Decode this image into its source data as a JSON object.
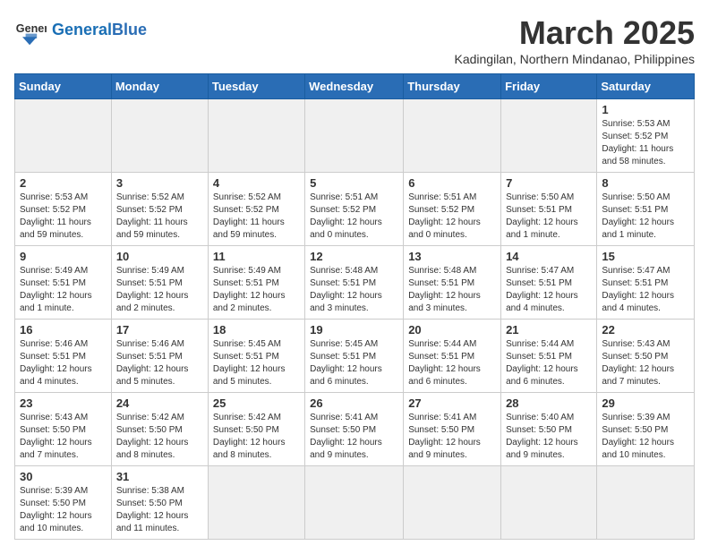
{
  "header": {
    "logo_general": "General",
    "logo_blue": "Blue",
    "month_title": "March 2025",
    "subtitle": "Kadingilan, Northern Mindanao, Philippines"
  },
  "weekdays": [
    "Sunday",
    "Monday",
    "Tuesday",
    "Wednesday",
    "Thursday",
    "Friday",
    "Saturday"
  ],
  "weeks": [
    [
      {
        "day": "",
        "info": "",
        "empty": true
      },
      {
        "day": "",
        "info": "",
        "empty": true
      },
      {
        "day": "",
        "info": "",
        "empty": true
      },
      {
        "day": "",
        "info": "",
        "empty": true
      },
      {
        "day": "",
        "info": "",
        "empty": true
      },
      {
        "day": "",
        "info": "",
        "empty": true
      },
      {
        "day": "1",
        "info": "Sunrise: 5:53 AM\nSunset: 5:52 PM\nDaylight: 11 hours and 58 minutes.",
        "empty": false
      }
    ],
    [
      {
        "day": "2",
        "info": "Sunrise: 5:53 AM\nSunset: 5:52 PM\nDaylight: 11 hours and 59 minutes.",
        "empty": false
      },
      {
        "day": "3",
        "info": "Sunrise: 5:52 AM\nSunset: 5:52 PM\nDaylight: 11 hours and 59 minutes.",
        "empty": false
      },
      {
        "day": "4",
        "info": "Sunrise: 5:52 AM\nSunset: 5:52 PM\nDaylight: 11 hours and 59 minutes.",
        "empty": false
      },
      {
        "day": "5",
        "info": "Sunrise: 5:51 AM\nSunset: 5:52 PM\nDaylight: 12 hours and 0 minutes.",
        "empty": false
      },
      {
        "day": "6",
        "info": "Sunrise: 5:51 AM\nSunset: 5:52 PM\nDaylight: 12 hours and 0 minutes.",
        "empty": false
      },
      {
        "day": "7",
        "info": "Sunrise: 5:50 AM\nSunset: 5:51 PM\nDaylight: 12 hours and 1 minute.",
        "empty": false
      },
      {
        "day": "8",
        "info": "Sunrise: 5:50 AM\nSunset: 5:51 PM\nDaylight: 12 hours and 1 minute.",
        "empty": false
      }
    ],
    [
      {
        "day": "9",
        "info": "Sunrise: 5:49 AM\nSunset: 5:51 PM\nDaylight: 12 hours and 1 minute.",
        "empty": false
      },
      {
        "day": "10",
        "info": "Sunrise: 5:49 AM\nSunset: 5:51 PM\nDaylight: 12 hours and 2 minutes.",
        "empty": false
      },
      {
        "day": "11",
        "info": "Sunrise: 5:49 AM\nSunset: 5:51 PM\nDaylight: 12 hours and 2 minutes.",
        "empty": false
      },
      {
        "day": "12",
        "info": "Sunrise: 5:48 AM\nSunset: 5:51 PM\nDaylight: 12 hours and 3 minutes.",
        "empty": false
      },
      {
        "day": "13",
        "info": "Sunrise: 5:48 AM\nSunset: 5:51 PM\nDaylight: 12 hours and 3 minutes.",
        "empty": false
      },
      {
        "day": "14",
        "info": "Sunrise: 5:47 AM\nSunset: 5:51 PM\nDaylight: 12 hours and 4 minutes.",
        "empty": false
      },
      {
        "day": "15",
        "info": "Sunrise: 5:47 AM\nSunset: 5:51 PM\nDaylight: 12 hours and 4 minutes.",
        "empty": false
      }
    ],
    [
      {
        "day": "16",
        "info": "Sunrise: 5:46 AM\nSunset: 5:51 PM\nDaylight: 12 hours and 4 minutes.",
        "empty": false
      },
      {
        "day": "17",
        "info": "Sunrise: 5:46 AM\nSunset: 5:51 PM\nDaylight: 12 hours and 5 minutes.",
        "empty": false
      },
      {
        "day": "18",
        "info": "Sunrise: 5:45 AM\nSunset: 5:51 PM\nDaylight: 12 hours and 5 minutes.",
        "empty": false
      },
      {
        "day": "19",
        "info": "Sunrise: 5:45 AM\nSunset: 5:51 PM\nDaylight: 12 hours and 6 minutes.",
        "empty": false
      },
      {
        "day": "20",
        "info": "Sunrise: 5:44 AM\nSunset: 5:51 PM\nDaylight: 12 hours and 6 minutes.",
        "empty": false
      },
      {
        "day": "21",
        "info": "Sunrise: 5:44 AM\nSunset: 5:51 PM\nDaylight: 12 hours and 6 minutes.",
        "empty": false
      },
      {
        "day": "22",
        "info": "Sunrise: 5:43 AM\nSunset: 5:50 PM\nDaylight: 12 hours and 7 minutes.",
        "empty": false
      }
    ],
    [
      {
        "day": "23",
        "info": "Sunrise: 5:43 AM\nSunset: 5:50 PM\nDaylight: 12 hours and 7 minutes.",
        "empty": false
      },
      {
        "day": "24",
        "info": "Sunrise: 5:42 AM\nSunset: 5:50 PM\nDaylight: 12 hours and 8 minutes.",
        "empty": false
      },
      {
        "day": "25",
        "info": "Sunrise: 5:42 AM\nSunset: 5:50 PM\nDaylight: 12 hours and 8 minutes.",
        "empty": false
      },
      {
        "day": "26",
        "info": "Sunrise: 5:41 AM\nSunset: 5:50 PM\nDaylight: 12 hours and 9 minutes.",
        "empty": false
      },
      {
        "day": "27",
        "info": "Sunrise: 5:41 AM\nSunset: 5:50 PM\nDaylight: 12 hours and 9 minutes.",
        "empty": false
      },
      {
        "day": "28",
        "info": "Sunrise: 5:40 AM\nSunset: 5:50 PM\nDaylight: 12 hours and 9 minutes.",
        "empty": false
      },
      {
        "day": "29",
        "info": "Sunrise: 5:39 AM\nSunset: 5:50 PM\nDaylight: 12 hours and 10 minutes.",
        "empty": false
      }
    ],
    [
      {
        "day": "30",
        "info": "Sunrise: 5:39 AM\nSunset: 5:50 PM\nDaylight: 12 hours and 10 minutes.",
        "empty": false
      },
      {
        "day": "31",
        "info": "Sunrise: 5:38 AM\nSunset: 5:50 PM\nDaylight: 12 hours and 11 minutes.",
        "empty": false
      },
      {
        "day": "",
        "info": "",
        "empty": true
      },
      {
        "day": "",
        "info": "",
        "empty": true
      },
      {
        "day": "",
        "info": "",
        "empty": true
      },
      {
        "day": "",
        "info": "",
        "empty": true
      },
      {
        "day": "",
        "info": "",
        "empty": true
      }
    ]
  ]
}
